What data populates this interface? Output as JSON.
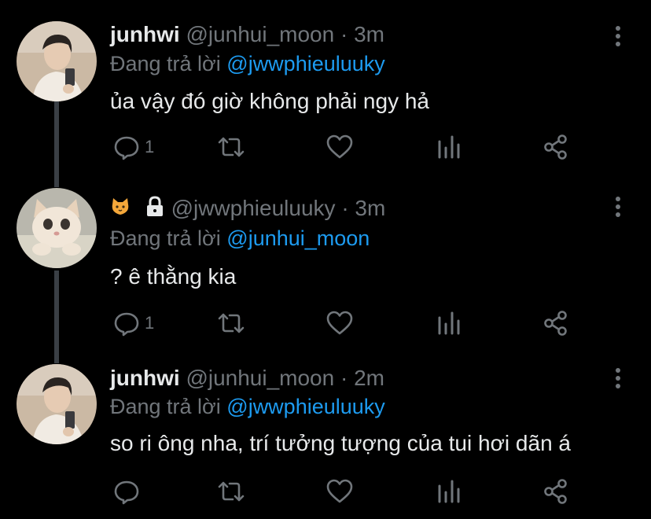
{
  "theme": {
    "background": "#000000",
    "text": "#e7e9ea",
    "muted": "#71767b",
    "accent": "#1d9bf0",
    "thread_line": "#3a3f45"
  },
  "tweets": [
    {
      "display_name": "junhwi",
      "handle": "@junhui_moon",
      "separator": "·",
      "time": "3m",
      "reply_prefix": "Đang trả lời",
      "reply_to": "@jwwphieuluuky",
      "text": "ủa vậy đó giờ không phải ngy hả",
      "reply_count": "1",
      "avatar_icon": "person-photo-avatar",
      "icons": [
        "cat-emoji",
        "lock-icon"
      ]
    },
    {
      "display_name": "",
      "handle": "@jwwphieuluuky",
      "separator": "·",
      "time": "3m",
      "reply_prefix": "Đang trả lời",
      "reply_to": "@junhui_moon",
      "text": "? ê thằng kia",
      "reply_count": "1",
      "avatar_icon": "kitten-photo-avatar"
    },
    {
      "display_name": "junhwi",
      "handle": "@junhui_moon",
      "separator": "·",
      "time": "2m",
      "reply_prefix": "Đang trả lời",
      "reply_to": "@jwwphieuluuky",
      "text": "so ri ông nha, trí tưởng tượng của tui hơi dãn á",
      "reply_count": "",
      "avatar_icon": "person-photo-avatar"
    }
  ]
}
